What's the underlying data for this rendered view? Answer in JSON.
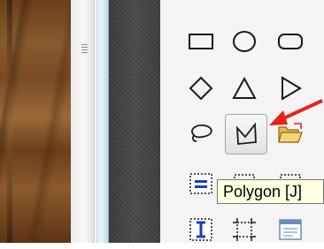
{
  "toolbox": {
    "tools": [
      {
        "name": "rectangle-tool"
      },
      {
        "name": "ellipse-tool"
      },
      {
        "name": "rounded-rectangle-tool"
      },
      {
        "name": "diamond-tool"
      },
      {
        "name": "triangle-tool"
      },
      {
        "name": "arrow-shape-tool"
      },
      {
        "name": "lasso-tool"
      },
      {
        "name": "polygon-tool",
        "selected": true
      },
      {
        "name": "open-folder-tool"
      },
      {
        "name": "equals-box-tool"
      },
      {
        "name": "text-tool"
      },
      {
        "name": "dotted-box-tool"
      },
      {
        "name": "window-tool"
      }
    ]
  },
  "tooltip": {
    "text": "Polygon [J]"
  },
  "colors": {
    "arrow": "#e8231b",
    "tooltip_bg": "#ffffe1",
    "icon_stroke": "#1a1a1a",
    "accent_blue": "#1c3fbf"
  }
}
